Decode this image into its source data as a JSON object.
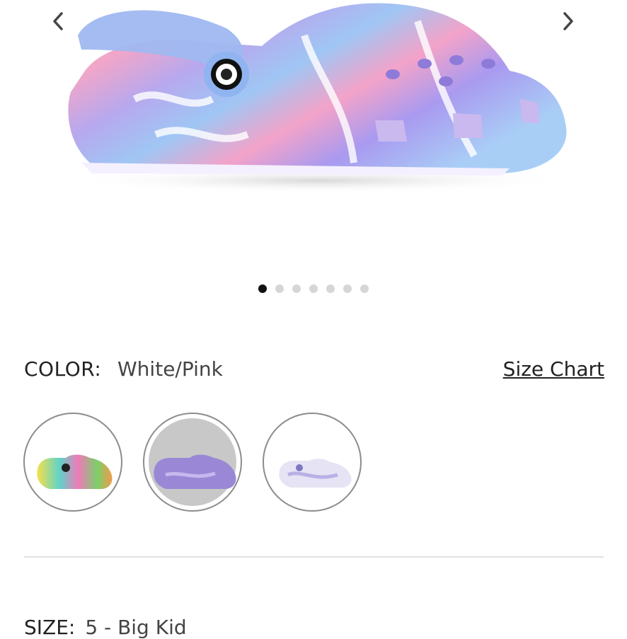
{
  "gallery": {
    "slide_count": 7,
    "active_slide": 1,
    "product_icon": "marbled-clog-image",
    "prev_icon": "chevron-left-icon",
    "next_icon": "chevron-right-icon"
  },
  "color": {
    "label": "COLOR:",
    "value": "White/Pink",
    "size_chart_label": "Size Chart",
    "swatches": [
      {
        "name": "multi-neon",
        "selected": false
      },
      {
        "name": "lavender-purple",
        "selected": true
      },
      {
        "name": "white-lilac",
        "selected": false
      }
    ]
  },
  "size": {
    "label": "SIZE:",
    "value": "5 - Big Kid"
  },
  "colors": {
    "active_dot": "#111111",
    "inactive_dot": "#d6d6d6",
    "selected_swatch_bg": "#c8c8c8"
  }
}
